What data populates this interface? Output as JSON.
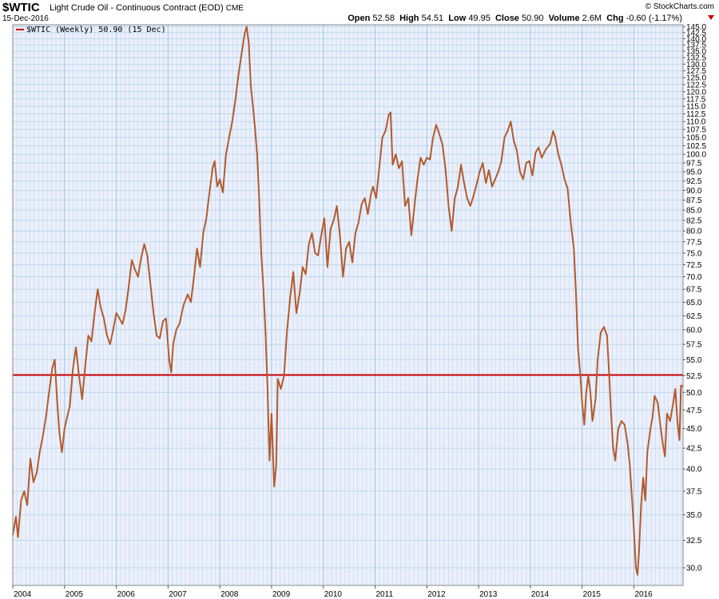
{
  "header": {
    "symbol": "$WTIC",
    "description": "Light Crude Oil - Continuous Contract (EOD)",
    "exchange": "CME",
    "date": "15-Dec-2016",
    "brand": "© StockCharts.com",
    "open_label": "Open",
    "open": "52.58",
    "high_label": "High",
    "high": "54.51",
    "low_label": "Low",
    "low": "49.95",
    "close_label": "Close",
    "close": "50.90",
    "volume_label": "Volume",
    "volume": "2.6M",
    "chg_label": "Chg",
    "chg": "-0.60 (-1.17%)"
  },
  "legend": {
    "label": "$WTIC (Weekly) 50.90 (15 Dec)"
  },
  "colors": {
    "price_line": "#b35a2d",
    "reference_line": "#cc0000",
    "grid": "#b9d6ea",
    "plot_bg": "#ecf0fc"
  },
  "chart_data": {
    "type": "line",
    "x_unit": "year",
    "xlim": [
      2004.0,
      2016.95
    ],
    "ylim": [
      28.5,
      145.8
    ],
    "log_scale": true,
    "grid": true,
    "legend_position": "top-left",
    "x_ticks": [
      2004,
      2005,
      2006,
      2007,
      2008,
      2009,
      2010,
      2011,
      2012,
      2013,
      2014,
      2015,
      2016
    ],
    "y_ticks": [
      30.0,
      32.5,
      35.0,
      37.5,
      40.0,
      42.5,
      45.0,
      47.5,
      50.0,
      52.5,
      55.0,
      57.5,
      60.0,
      62.5,
      65.0,
      67.5,
      70.0,
      72.5,
      75.0,
      77.5,
      80.0,
      82.5,
      85.0,
      87.5,
      90.0,
      92.5,
      95.0,
      97.5,
      100.0,
      102.5,
      105.0,
      107.5,
      110.0,
      112.5,
      115.0,
      117.5,
      120.0,
      122.5,
      125.0,
      127.5,
      130.0,
      132.5,
      135.0,
      137.5,
      140.0,
      142.5,
      145.0
    ],
    "horizontal_line": 52.6,
    "series": [
      {
        "name": "$WTIC (Weekly)",
        "points": [
          [
            2004.0,
            33.0
          ],
          [
            2004.06,
            34.8
          ],
          [
            2004.1,
            32.8
          ],
          [
            2004.16,
            36.5
          ],
          [
            2004.22,
            37.5
          ],
          [
            2004.28,
            36.0
          ],
          [
            2004.34,
            41.2
          ],
          [
            2004.4,
            38.5
          ],
          [
            2004.46,
            39.5
          ],
          [
            2004.52,
            42.0
          ],
          [
            2004.58,
            44.0
          ],
          [
            2004.64,
            46.5
          ],
          [
            2004.7,
            50.0
          ],
          [
            2004.76,
            53.5
          ],
          [
            2004.81,
            55.0
          ],
          [
            2004.86,
            48.5
          ],
          [
            2004.9,
            44.5
          ],
          [
            2004.95,
            42.0
          ],
          [
            2005.0,
            45.0
          ],
          [
            2005.05,
            46.5
          ],
          [
            2005.1,
            48.0
          ],
          [
            2005.16,
            53.5
          ],
          [
            2005.22,
            57.0
          ],
          [
            2005.28,
            52.5
          ],
          [
            2005.34,
            49.0
          ],
          [
            2005.4,
            54.0
          ],
          [
            2005.46,
            59.0
          ],
          [
            2005.52,
            58.0
          ],
          [
            2005.58,
            63.0
          ],
          [
            2005.64,
            67.5
          ],
          [
            2005.7,
            64.0
          ],
          [
            2005.76,
            62.0
          ],
          [
            2005.82,
            59.0
          ],
          [
            2005.88,
            57.5
          ],
          [
            2005.94,
            60.0
          ],
          [
            2006.0,
            63.0
          ],
          [
            2006.06,
            62.0
          ],
          [
            2006.12,
            61.0
          ],
          [
            2006.18,
            63.5
          ],
          [
            2006.24,
            68.0
          ],
          [
            2006.3,
            73.5
          ],
          [
            2006.36,
            71.5
          ],
          [
            2006.42,
            70.0
          ],
          [
            2006.48,
            74.0
          ],
          [
            2006.54,
            77.0
          ],
          [
            2006.6,
            74.5
          ],
          [
            2006.66,
            68.5
          ],
          [
            2006.72,
            63.0
          ],
          [
            2006.78,
            59.0
          ],
          [
            2006.84,
            58.5
          ],
          [
            2006.9,
            61.5
          ],
          [
            2006.96,
            62.0
          ],
          [
            2007.02,
            55.0
          ],
          [
            2007.06,
            53.0
          ],
          [
            2007.1,
            57.5
          ],
          [
            2007.16,
            60.0
          ],
          [
            2007.22,
            61.0
          ],
          [
            2007.3,
            64.5
          ],
          [
            2007.38,
            66.5
          ],
          [
            2007.44,
            65.0
          ],
          [
            2007.5,
            70.0
          ],
          [
            2007.56,
            76.0
          ],
          [
            2007.62,
            72.0
          ],
          [
            2007.68,
            79.5
          ],
          [
            2007.74,
            83.0
          ],
          [
            2007.8,
            89.5
          ],
          [
            2007.86,
            96.0
          ],
          [
            2007.9,
            98.0
          ],
          [
            2007.95,
            91.0
          ],
          [
            2008.0,
            93.0
          ],
          [
            2008.06,
            89.5
          ],
          [
            2008.12,
            100.0
          ],
          [
            2008.18,
            105.0
          ],
          [
            2008.24,
            110.0
          ],
          [
            2008.3,
            117.0
          ],
          [
            2008.36,
            126.0
          ],
          [
            2008.42,
            134.0
          ],
          [
            2008.48,
            142.0
          ],
          [
            2008.52,
            145.0
          ],
          [
            2008.56,
            138.0
          ],
          [
            2008.6,
            122.0
          ],
          [
            2008.64,
            115.0
          ],
          [
            2008.68,
            108.0
          ],
          [
            2008.72,
            100.0
          ],
          [
            2008.76,
            88.0
          ],
          [
            2008.8,
            75.0
          ],
          [
            2008.84,
            68.0
          ],
          [
            2008.88,
            60.0
          ],
          [
            2008.92,
            51.0
          ],
          [
            2008.96,
            41.0
          ],
          [
            2009.0,
            47.0
          ],
          [
            2009.05,
            38.0
          ],
          [
            2009.09,
            40.5
          ],
          [
            2009.12,
            52.0
          ],
          [
            2009.18,
            50.5
          ],
          [
            2009.24,
            52.5
          ],
          [
            2009.3,
            60.0
          ],
          [
            2009.36,
            66.0
          ],
          [
            2009.42,
            71.0
          ],
          [
            2009.48,
            63.0
          ],
          [
            2009.54,
            66.5
          ],
          [
            2009.6,
            72.0
          ],
          [
            2009.66,
            70.5
          ],
          [
            2009.72,
            77.0
          ],
          [
            2009.78,
            79.5
          ],
          [
            2009.84,
            75.0
          ],
          [
            2009.9,
            74.5
          ],
          [
            2009.96,
            79.0
          ],
          [
            2010.02,
            83.0
          ],
          [
            2010.08,
            72.0
          ],
          [
            2010.14,
            80.5
          ],
          [
            2010.2,
            82.5
          ],
          [
            2010.26,
            86.0
          ],
          [
            2010.32,
            79.0
          ],
          [
            2010.38,
            70.0
          ],
          [
            2010.44,
            76.0
          ],
          [
            2010.5,
            77.5
          ],
          [
            2010.56,
            73.0
          ],
          [
            2010.62,
            79.5
          ],
          [
            2010.68,
            82.0
          ],
          [
            2010.74,
            86.5
          ],
          [
            2010.8,
            88.0
          ],
          [
            2010.86,
            84.0
          ],
          [
            2010.92,
            89.0
          ],
          [
            2010.96,
            91.0
          ],
          [
            2011.02,
            88.0
          ],
          [
            2011.08,
            96.0
          ],
          [
            2011.14,
            105.0
          ],
          [
            2011.2,
            107.0
          ],
          [
            2011.26,
            112.0
          ],
          [
            2011.3,
            113.0
          ],
          [
            2011.34,
            97.0
          ],
          [
            2011.4,
            100.0
          ],
          [
            2011.46,
            96.0
          ],
          [
            2011.52,
            98.0
          ],
          [
            2011.58,
            86.0
          ],
          [
            2011.64,
            88.0
          ],
          [
            2011.7,
            79.0
          ],
          [
            2011.76,
            86.0
          ],
          [
            2011.82,
            93.0
          ],
          [
            2011.88,
            99.0
          ],
          [
            2011.94,
            97.0
          ],
          [
            2012.0,
            99.0
          ],
          [
            2012.06,
            98.5
          ],
          [
            2012.12,
            105.0
          ],
          [
            2012.18,
            109.0
          ],
          [
            2012.24,
            106.0
          ],
          [
            2012.3,
            103.0
          ],
          [
            2012.36,
            96.0
          ],
          [
            2012.42,
            86.0
          ],
          [
            2012.48,
            80.0
          ],
          [
            2012.54,
            88.0
          ],
          [
            2012.6,
            91.0
          ],
          [
            2012.66,
            97.0
          ],
          [
            2012.72,
            92.0
          ],
          [
            2012.78,
            88.0
          ],
          [
            2012.84,
            86.0
          ],
          [
            2012.9,
            88.5
          ],
          [
            2012.96,
            91.5
          ],
          [
            2013.02,
            95.0
          ],
          [
            2013.08,
            97.5
          ],
          [
            2013.14,
            92.0
          ],
          [
            2013.2,
            95.5
          ],
          [
            2013.26,
            91.0
          ],
          [
            2013.32,
            93.0
          ],
          [
            2013.38,
            95.0
          ],
          [
            2013.44,
            98.0
          ],
          [
            2013.5,
            105.0
          ],
          [
            2013.56,
            107.0
          ],
          [
            2013.62,
            110.0
          ],
          [
            2013.68,
            104.0
          ],
          [
            2013.74,
            101.0
          ],
          [
            2013.8,
            95.0
          ],
          [
            2013.86,
            93.0
          ],
          [
            2013.92,
            97.5
          ],
          [
            2013.98,
            98.0
          ],
          [
            2014.04,
            94.0
          ],
          [
            2014.1,
            100.5
          ],
          [
            2014.16,
            102.0
          ],
          [
            2014.22,
            99.0
          ],
          [
            2014.3,
            101.5
          ],
          [
            2014.38,
            103.0
          ],
          [
            2014.44,
            107.0
          ],
          [
            2014.48,
            105.0
          ],
          [
            2014.54,
            100.0
          ],
          [
            2014.6,
            97.0
          ],
          [
            2014.66,
            93.0
          ],
          [
            2014.72,
            90.5
          ],
          [
            2014.78,
            82.0
          ],
          [
            2014.84,
            76.0
          ],
          [
            2014.88,
            67.0
          ],
          [
            2014.92,
            57.0
          ],
          [
            2014.96,
            53.0
          ],
          [
            2015.0,
            48.5
          ],
          [
            2015.04,
            45.5
          ],
          [
            2015.08,
            50.0
          ],
          [
            2015.12,
            52.5
          ],
          [
            2015.16,
            50.0
          ],
          [
            2015.2,
            46.0
          ],
          [
            2015.26,
            49.0
          ],
          [
            2015.3,
            55.0
          ],
          [
            2015.36,
            59.5
          ],
          [
            2015.42,
            60.5
          ],
          [
            2015.48,
            59.0
          ],
          [
            2015.52,
            53.0
          ],
          [
            2015.56,
            47.0
          ],
          [
            2015.6,
            42.5
          ],
          [
            2015.64,
            41.0
          ],
          [
            2015.7,
            45.0
          ],
          [
            2015.76,
            46.0
          ],
          [
            2015.82,
            45.5
          ],
          [
            2015.88,
            43.0
          ],
          [
            2015.92,
            40.5
          ],
          [
            2015.96,
            37.0
          ],
          [
            2016.0,
            33.5
          ],
          [
            2016.04,
            30.0
          ],
          [
            2016.07,
            29.4
          ],
          [
            2016.1,
            31.5
          ],
          [
            2016.14,
            36.0
          ],
          [
            2016.18,
            39.0
          ],
          [
            2016.22,
            36.5
          ],
          [
            2016.26,
            42.0
          ],
          [
            2016.32,
            45.0
          ],
          [
            2016.36,
            46.5
          ],
          [
            2016.4,
            49.5
          ],
          [
            2016.46,
            48.5
          ],
          [
            2016.52,
            45.0
          ],
          [
            2016.56,
            43.0
          ],
          [
            2016.6,
            41.5
          ],
          [
            2016.64,
            47.0
          ],
          [
            2016.7,
            46.0
          ],
          [
            2016.76,
            48.5
          ],
          [
            2016.8,
            50.5
          ],
          [
            2016.84,
            46.0
          ],
          [
            2016.88,
            43.5
          ],
          [
            2016.91,
            51.0
          ],
          [
            2016.95,
            50.9
          ]
        ]
      }
    ]
  }
}
